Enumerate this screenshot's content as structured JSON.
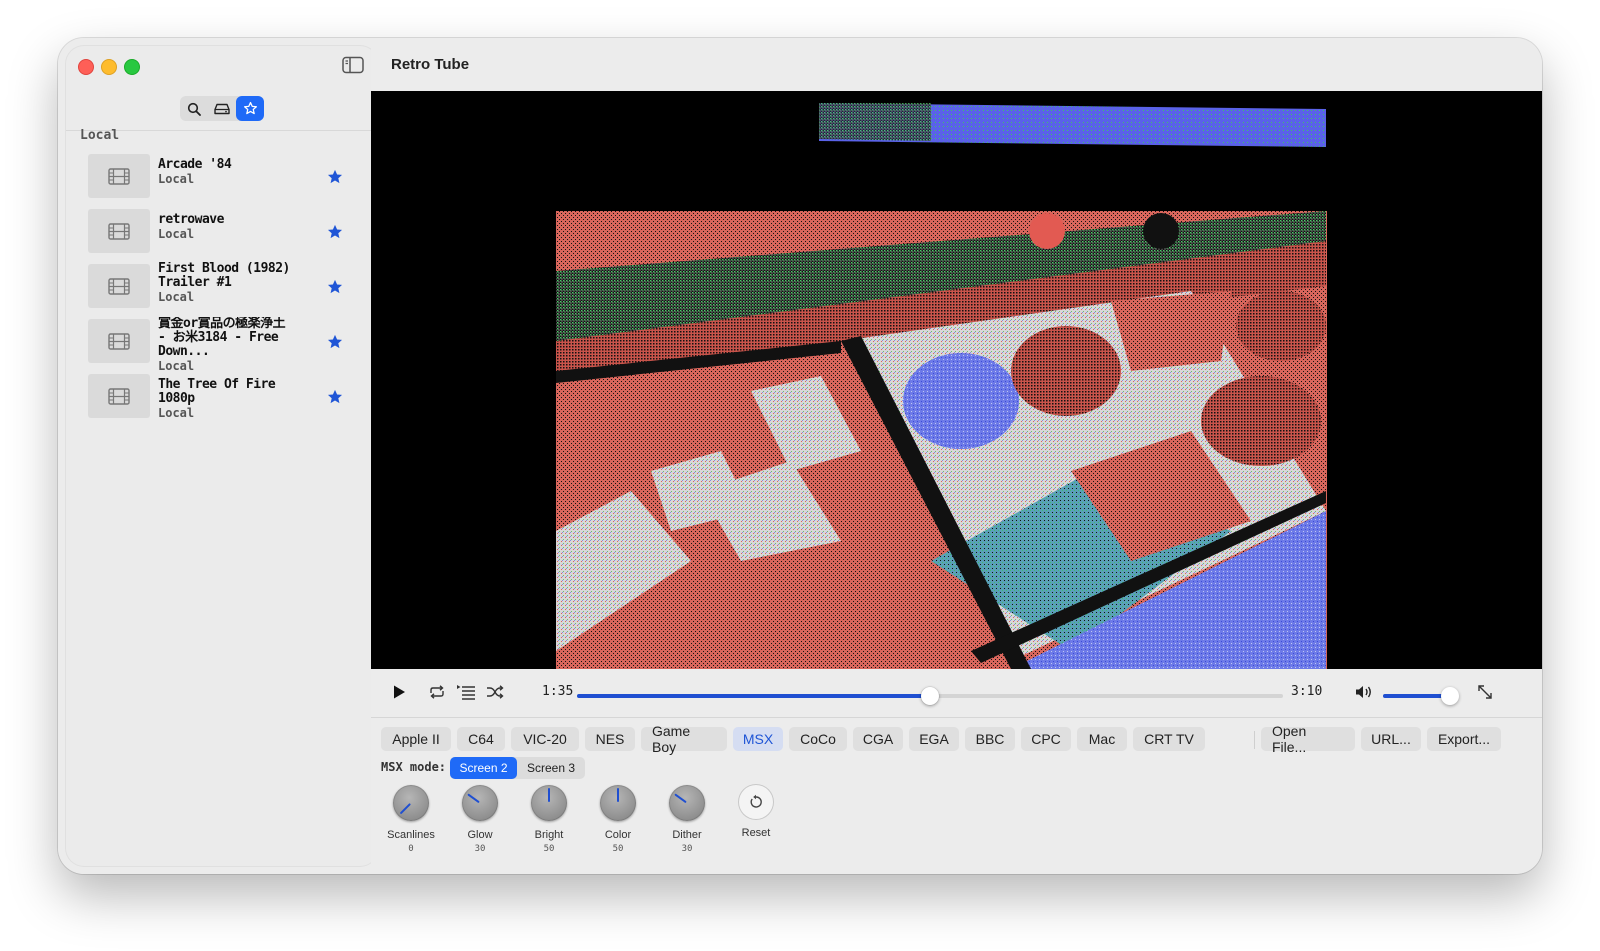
{
  "app": {
    "title": "Retro Tube"
  },
  "sidebar": {
    "section_title": "Local",
    "items": [
      {
        "title": "Arcade '84",
        "subtitle": "Local",
        "favorited": true
      },
      {
        "title": "retrowave",
        "subtitle": "Local",
        "favorited": true
      },
      {
        "title": "First Blood (1982)\nTrailer #1",
        "subtitle": "Local",
        "favorited": true
      },
      {
        "title": "賞金or賞品の極楽浄土\n- お米3184 - Free Down...",
        "subtitle": "Local",
        "favorited": true
      },
      {
        "title": "The Tree Of Fire 1080p",
        "subtitle": "Local",
        "favorited": true
      }
    ]
  },
  "player": {
    "current_time": "1:35",
    "total_time": "3:10",
    "progress": 0.5,
    "volume": 0.9
  },
  "systems": {
    "buttons": [
      "Apple II",
      "C64",
      "VIC-20",
      "NES",
      "Game Boy",
      "MSX",
      "CoCo",
      "CGA",
      "EGA",
      "BBC",
      "CPC",
      "Mac",
      "CRT TV"
    ],
    "active": "MSX",
    "actions": [
      "Open File...",
      "URL...",
      "Export..."
    ]
  },
  "mode": {
    "label": "MSX mode:",
    "options": [
      "Screen 2",
      "Screen 3"
    ],
    "active": "Screen 2"
  },
  "knobs": [
    {
      "label": "Scanlines",
      "value": "0"
    },
    {
      "label": "Glow",
      "value": "30"
    },
    {
      "label": "Bright",
      "value": "50"
    },
    {
      "label": "Color",
      "value": "50"
    },
    {
      "label": "Dither",
      "value": "30"
    }
  ],
  "reset_label": "Reset",
  "colors": {
    "accent": "#1f6af7",
    "fill": "#1f4fd1",
    "star": "#1f55d6"
  }
}
